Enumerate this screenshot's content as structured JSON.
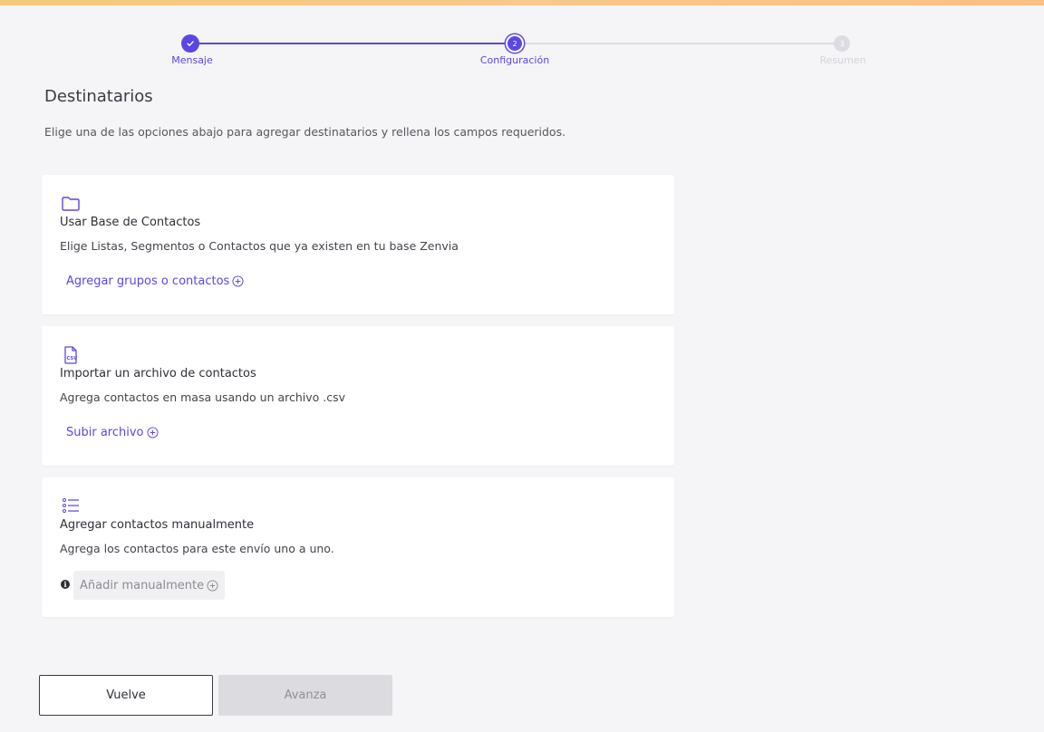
{
  "stepper": {
    "steps": [
      {
        "label": "Mensaje",
        "number": "1",
        "state": "done"
      },
      {
        "label": "Configuración",
        "number": "2",
        "state": "current"
      },
      {
        "label": "Resumen",
        "number": "3",
        "state": "pending"
      }
    ]
  },
  "header": {
    "title": "Destinatarios",
    "subtitle": "Elige una de las opciones abajo para agregar destinatarios y rellena los campos requeridos."
  },
  "cards": [
    {
      "icon": "folder-icon",
      "title": "Usar Base de Contactos",
      "description": "Elige Listas, Segmentos o Contactos que ya existen en tu base Zenvia",
      "action": "Agregar grupos o contactos"
    },
    {
      "icon": "csv-file-icon",
      "title": "Importar un archivo de contactos",
      "description": "Agrega contactos en masa usando un archivo .csv",
      "action": "Subir archivo"
    },
    {
      "icon": "list-icon",
      "title": "Agregar contactos manualmente",
      "description": "Agrega los contactos para este envío uno a uno.",
      "action": "Añadir manualmente"
    }
  ],
  "footer": {
    "back_label": "Vuelve",
    "next_label": "Avanza"
  },
  "colors": {
    "accent": "#5a47e6",
    "disabled": "#dcdce0"
  }
}
